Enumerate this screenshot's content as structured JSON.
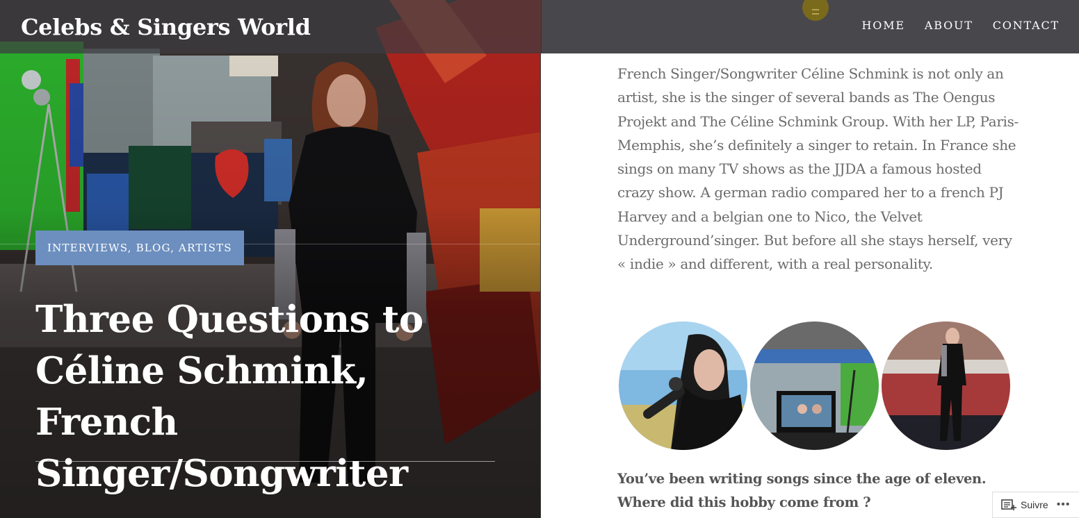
{
  "header": {
    "site_title": "Celebs & Singers World",
    "nav": [
      "HOME",
      "ABOUT",
      "CONTACT"
    ]
  },
  "hero": {
    "categories": "INTERVIEWS, BLOG, ARTISTS",
    "title": "Three Questions to Céline Schmink, French Singer/Songwriter"
  },
  "article": {
    "intro": "French Singer/Songwriter Céline Schmink is not only an artist, she is the singer of several bands as The Oengus Projekt and The Céline Schmink Group. With her LP, Paris-Memphis, she’s definitely a singer to retain. In France she sings on many TV shows as the JJDA a famous hosted crazy show. A german radio compared her to a french PJ Harvey and a belgian one to Nico, the Velvet Underground’singer. But before all she stays herself, very « indie » and different, with a real personality.",
    "question": "You’ve been writing songs since the age of eleven. Where did this hobby come from ?"
  },
  "follow": {
    "label": "Suivre",
    "more": "•••"
  },
  "icons": {
    "menu": "menu-icon",
    "follow": "follow-icon"
  },
  "colors": {
    "header_bg": "#48484c",
    "badge_bg": "#6d8fbf",
    "menu_toggle": "#7a6a1c"
  }
}
